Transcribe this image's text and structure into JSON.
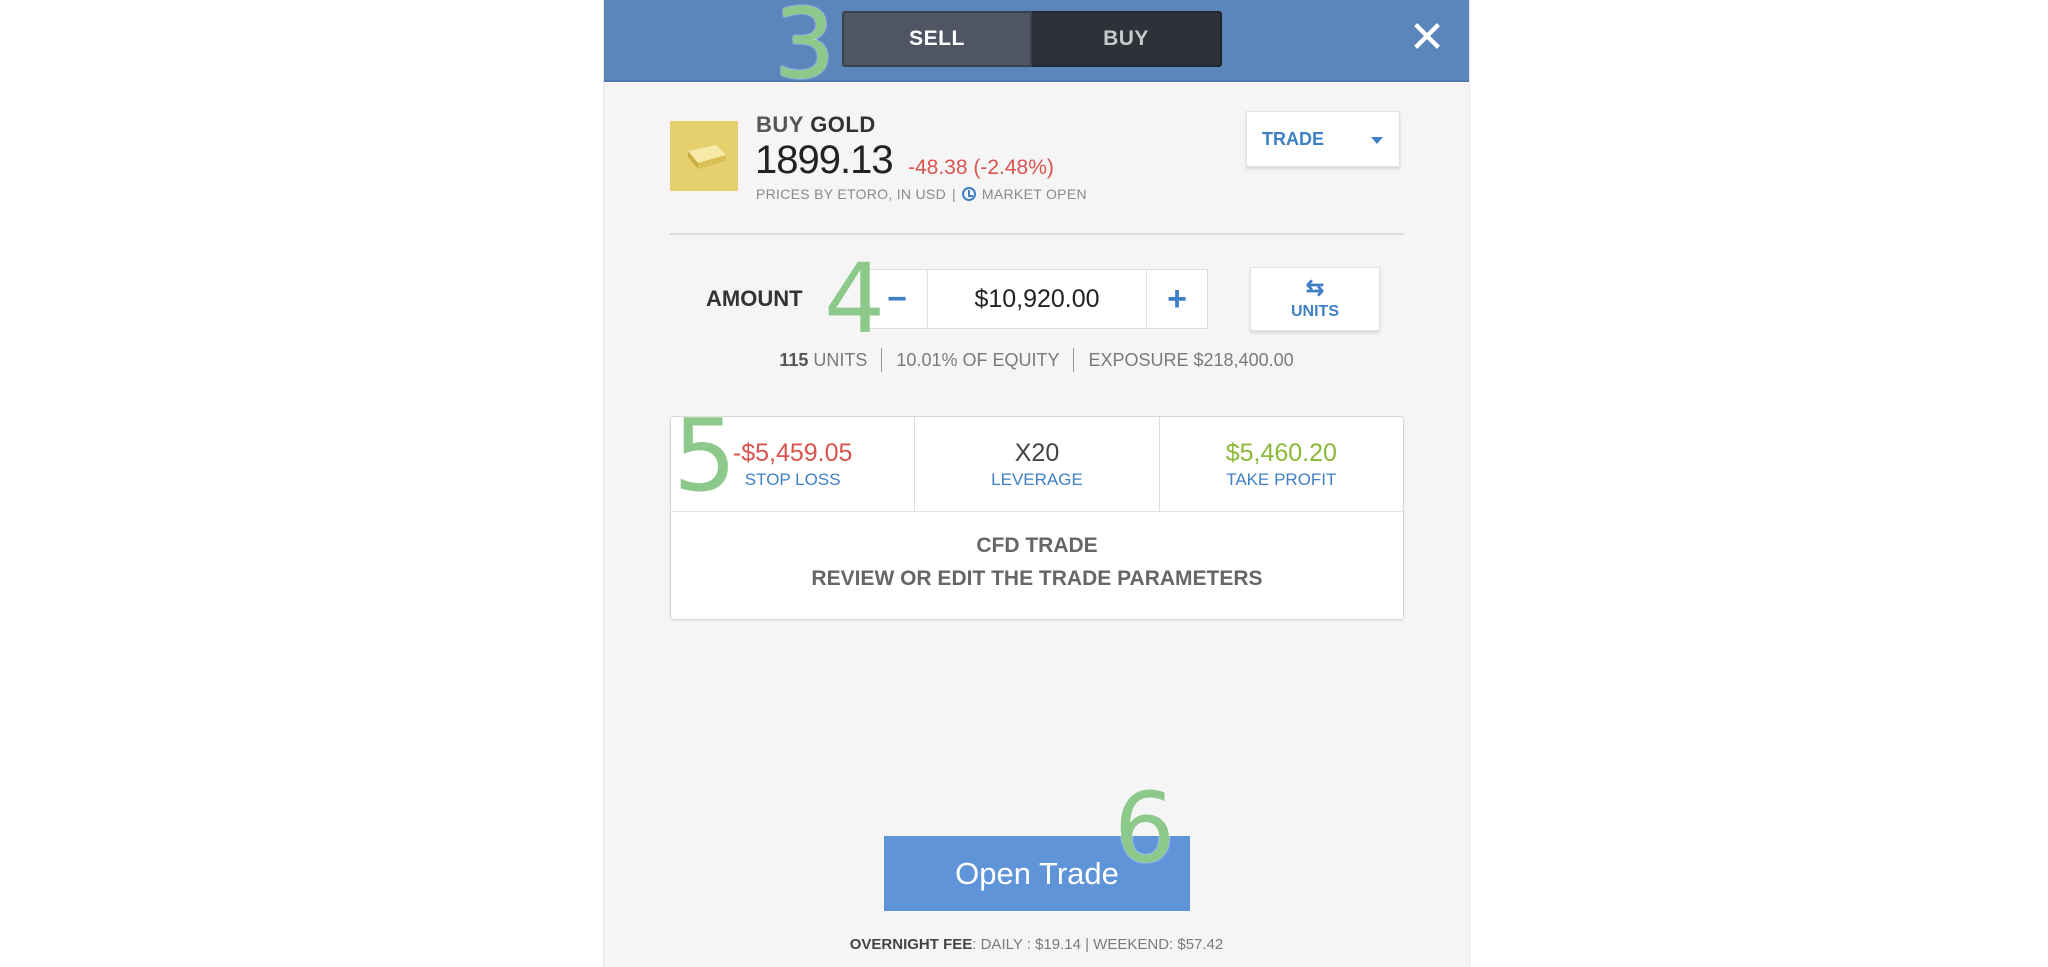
{
  "header": {
    "sell_label": "SELL",
    "buy_label": "BUY",
    "close_icon": "close-icon",
    "step_3": "3"
  },
  "instrument": {
    "action": "BUY",
    "name": "GOLD",
    "price": "1899.13",
    "change": "-48.38 (-2.48%)",
    "prices_by": "PRICES BY ETORO, IN USD",
    "separator": "|",
    "market_status": "MARKET OPEN",
    "icon": "gold-bar-icon",
    "change_color": "#d9534f"
  },
  "trade_dropdown": {
    "label": "TRADE"
  },
  "amount": {
    "label": "AMOUNT",
    "value": "$10,920.00",
    "minus": "−",
    "plus": "+",
    "units_button_label": "UNITS",
    "step_4": "4"
  },
  "info": {
    "units_number": "115",
    "units_text": "UNITS",
    "equity": "10.01% OF EQUITY",
    "exposure": "EXPOSURE $218,400.00"
  },
  "params": {
    "stop_loss_value": "-$5,459.05",
    "stop_loss_label": "STOP LOSS",
    "leverage_value": "X20",
    "leverage_label": "LEVERAGE",
    "take_profit_value": "$5,460.20",
    "take_profit_label": "TAKE PROFIT",
    "cfd_title": "CFD TRADE",
    "cfd_subtitle": "REVIEW OR EDIT THE TRADE PARAMETERS",
    "step_5": "5"
  },
  "footer": {
    "open_trade_label": "Open Trade",
    "step_6": "6",
    "fee_label": "OVERNIGHT FEE",
    "fee_details": ": DAILY : $19.14 | WEEKEND: $57.42"
  },
  "colors": {
    "header": "#5b86bc",
    "accent": "#3f7fc6",
    "negative": "#d9534f",
    "positive": "#8cb83a",
    "primary_button": "#5f95d8",
    "annotation": "#8cc98a"
  }
}
